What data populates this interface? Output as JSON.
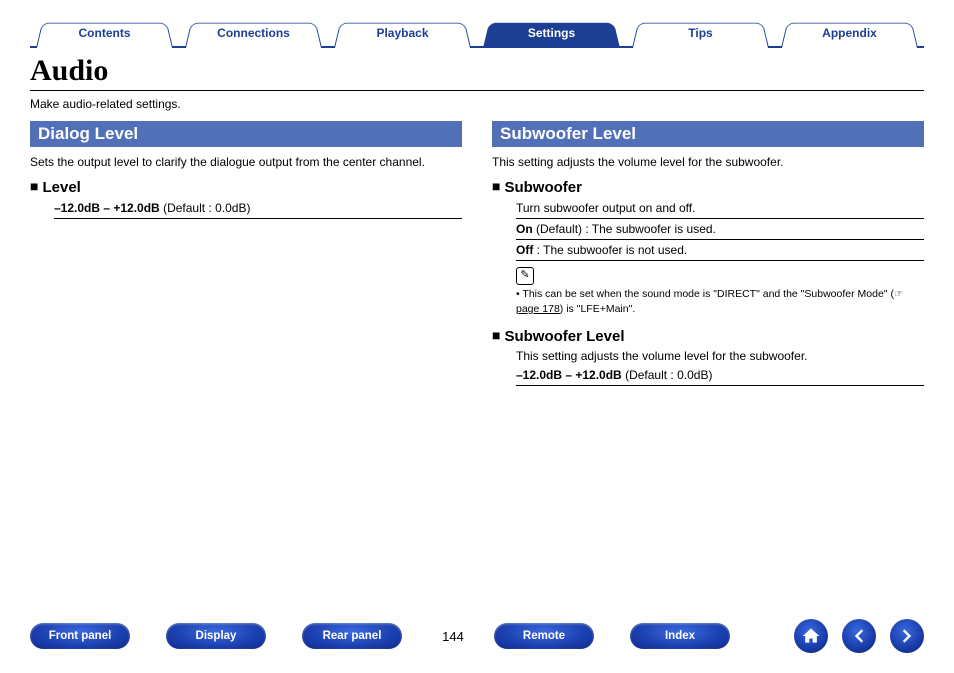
{
  "tabs": [
    {
      "label": "Contents",
      "active": false
    },
    {
      "label": "Connections",
      "active": false
    },
    {
      "label": "Playback",
      "active": false
    },
    {
      "label": "Settings",
      "active": true
    },
    {
      "label": "Tips",
      "active": false
    },
    {
      "label": "Appendix",
      "active": false
    }
  ],
  "page": {
    "title": "Audio",
    "desc": "Make audio-related settings.",
    "number": "144"
  },
  "left": {
    "heading": "Dialog Level",
    "desc": "Sets the output level to clarify the dialogue output from the center channel.",
    "sub1": {
      "title": "Level",
      "range": "–12.0dB – +12.0dB",
      "default": " (Default : 0.0dB)"
    }
  },
  "right": {
    "heading": "Subwoofer Level",
    "desc": "This setting adjusts the volume level for the subwoofer.",
    "sub1": {
      "title": "Subwoofer",
      "row1": "Turn subwoofer output on and off.",
      "row2_bold": "On",
      "row2_rest": " (Default) : The subwoofer is used.",
      "row3_bold": "Off",
      "row3_rest": " : The subwoofer is not used."
    },
    "note": {
      "bullet": "•",
      "text_a": "This can be set when the sound mode is \"DIRECT\" and the \"Subwoofer Mode\" (",
      "ref_icon": "☞",
      "link": "page 178",
      "text_b": ") is \"LFE+Main\"."
    },
    "sub2": {
      "title": "Subwoofer Level",
      "desc": "This setting adjusts the volume level for the subwoofer.",
      "range": "–12.0dB – +12.0dB",
      "default": " (Default : 0.0dB)"
    }
  },
  "bottom": {
    "buttons": [
      "Front panel",
      "Display",
      "Rear panel",
      "Remote",
      "Index"
    ]
  }
}
